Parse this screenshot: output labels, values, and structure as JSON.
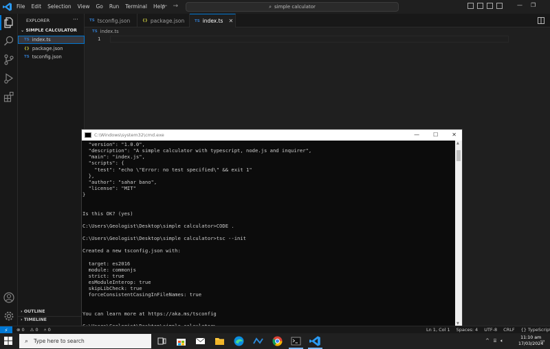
{
  "menu": [
    "File",
    "Edit",
    "Selection",
    "View",
    "Go",
    "Run",
    "Terminal",
    "Help"
  ],
  "command_center": {
    "text": "simple calculator"
  },
  "sidebar": {
    "title": "EXPLORER",
    "more": "···",
    "section": "SIMPLE CALCULATOR",
    "files": [
      {
        "icon": "TS",
        "name": "index.ts"
      },
      {
        "icon": "{}",
        "name": "package.json"
      },
      {
        "icon": "TS",
        "name": "tsconfig.json"
      }
    ],
    "outline": "OUTLINE",
    "timeline": "TIMELINE"
  },
  "tabs": [
    {
      "icon": "TS",
      "label": "tsconfig.json"
    },
    {
      "icon": "{}",
      "label": "package.json"
    },
    {
      "icon": "TS",
      "label": "index.ts"
    }
  ],
  "breadcrumb": {
    "icon": "TS",
    "file": "index.ts"
  },
  "editor": {
    "line_number": "1"
  },
  "ts_badge": "TS",
  "cmd": {
    "title": "C:\\Windows\\system32\\cmd.exe",
    "lines": [
      "  \"version\": \"1.0.0\",",
      "  \"description\": \"A simple calculator with typescript, node.js and inquirer\",",
      "  \"main\": \"index.js\",",
      "  \"scripts\": {",
      "    \"test\": \"echo \\\"Error: no test specified\\\" && exit 1\"",
      "  },",
      "  \"author\": \"sahar bano\",",
      "  \"license\": \"MIT\"",
      "}",
      "",
      "",
      "Is this OK? (yes)",
      "",
      "C:\\Users\\Geologist\\Desktop\\simple calculator>CODE .",
      "",
      "C:\\Users\\Geologist\\Desktop\\simple calculator>tsc --init",
      "",
      "Created a new tsconfig.json with:",
      "",
      "  target: es2016",
      "  module: commonjs",
      "  strict: true",
      "  esModuleInterop: true",
      "  skipLibCheck: true",
      "  forceConsistentCasingInFileNames: true",
      "",
      "",
      "You can learn more at https://aka.ms/tsconfig",
      "",
      "C:\\Users\\Geologist\\Desktop\\simple calculator>"
    ]
  },
  "status": {
    "remote": "⚡",
    "errors": "⊗ 0",
    "warnings": "⚠ 0",
    "ports": "⑃ 0",
    "position": "Ln 1, Col 1",
    "spaces": "Spaces: 4",
    "encoding": "UTF-8",
    "eol": "CRLF",
    "language": "{} TypeScript"
  },
  "taskbar": {
    "search_placeholder": "Type here to search",
    "time": "11:10 am",
    "date": "17/03/2024"
  },
  "colors": {
    "accent": "#0078d4",
    "ts": "#3178c6",
    "json": "#cbcb41"
  }
}
